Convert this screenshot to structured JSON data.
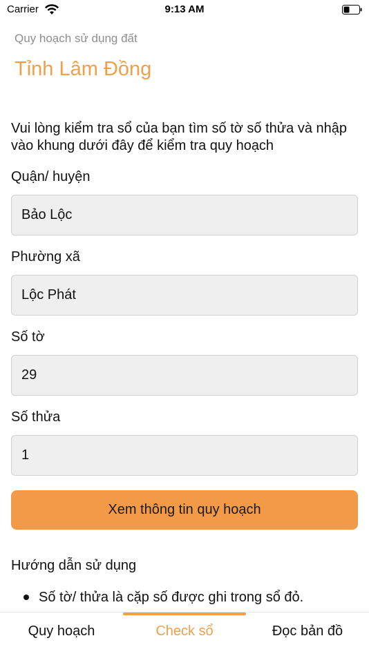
{
  "status_bar": {
    "carrier": "Carrier",
    "time": "9:13 AM"
  },
  "header": {
    "subtitle": "Quy hoạch sử dụng đất",
    "title": "Tỉnh Lâm Đồng"
  },
  "form": {
    "intro": "Vui lòng kiểm tra sổ của bạn tìm số tờ số thửa và nhập vào khung dưới đây để kiểm tra quy hoạch",
    "district_label": "Quận/ huyện",
    "district_value": "Bảo Lộc",
    "ward_label": "Phường xã",
    "ward_value": "Lộc Phát",
    "sheet_label": "Số tờ",
    "sheet_value": "29",
    "parcel_label": "Số thửa",
    "parcel_value": "1",
    "submit_label": "Xem thông tin quy hoạch"
  },
  "guide": {
    "title": "Hướng dẫn sử dụng",
    "items": [
      "Số tờ/ thửa là cặp số được ghi trong sổ đỏ."
    ]
  },
  "tabs": {
    "items": [
      {
        "label": "Quy hoạch",
        "active": false
      },
      {
        "label": "Check sổ",
        "active": true
      },
      {
        "label": "Đọc bản đồ",
        "active": false
      }
    ],
    "accent_color": "#f0a04b"
  },
  "icons": {
    "wifi": "wifi-icon",
    "battery": "battery-icon"
  }
}
